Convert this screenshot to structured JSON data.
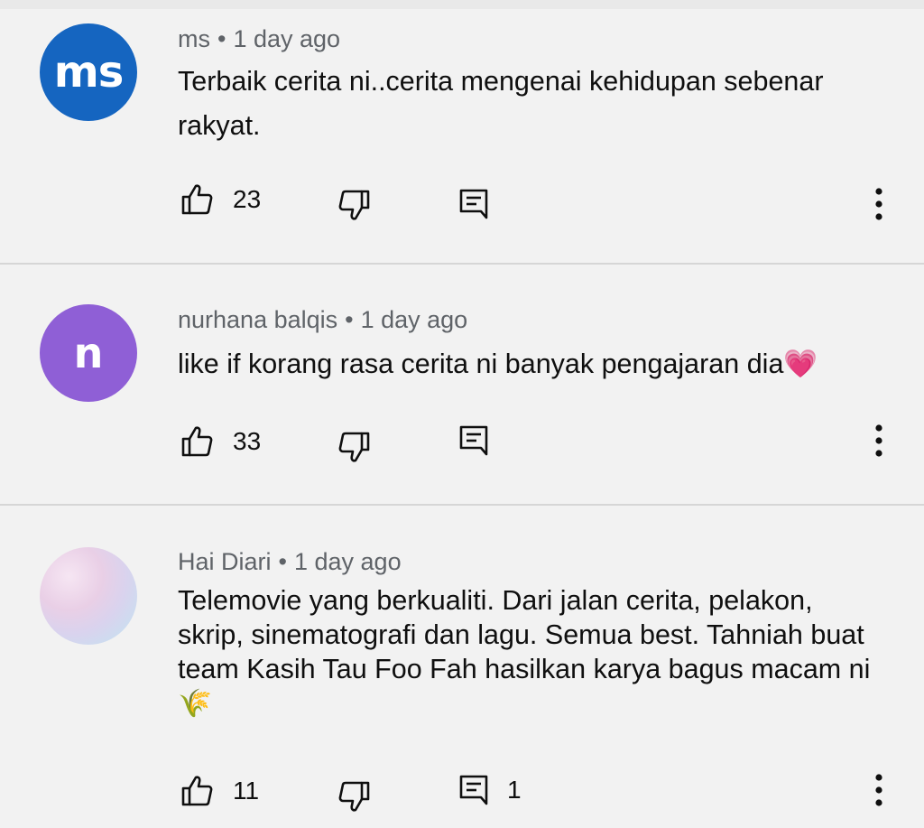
{
  "comments": [
    {
      "author": "ms",
      "time": "1 day ago",
      "avatar_letters": "ms",
      "avatar_color": "#1565c0",
      "text": "Terbaik cerita ni..cerita mengenai kehidupan sebenar rakyat.",
      "likes": "23",
      "replies": ""
    },
    {
      "author": "nurhana balqis",
      "time": "1 day ago",
      "avatar_letters": "n",
      "avatar_color": "#8f5fd6",
      "text": "like if korang rasa cerita ni banyak pengajaran dia",
      "emoji": "💗",
      "likes": "33",
      "replies": ""
    },
    {
      "author": "Hai Diari",
      "time": "1 day ago",
      "avatar_letters": "",
      "avatar_color": "#e6d3ea",
      "text": "Telemovie yang berkualiti. Dari jalan cerita, pelakon, skrip, sinematografi dan lagu. Semua best. Tahniah buat team Kasih Tau Foo Fah hasilkan karya bagus macam ni",
      "emoji": "🌾",
      "likes": "11",
      "replies": "1"
    }
  ],
  "icons": {
    "like": "thumbs-up-icon",
    "dislike": "thumbs-down-icon",
    "reply": "reply-comment-icon",
    "menu": "more-vert-icon"
  },
  "separator": "•"
}
